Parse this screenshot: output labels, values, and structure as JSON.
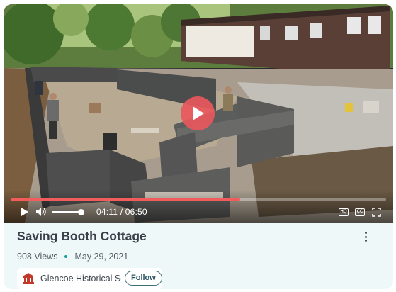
{
  "video": {
    "current_time": "04:11",
    "duration": "06:50",
    "progress": 0.612,
    "volume": 0.9,
    "hq_label": "HQ",
    "cc_label": "CC",
    "play_icon": "play-icon",
    "volume_icon": "volume-icon",
    "fullscreen_icon": "fullscreen-icon",
    "accent_color": "#f25c5c"
  },
  "info": {
    "title": "Saving Booth Cottage",
    "views": "908 Views",
    "date": "May 29, 2021",
    "more_icon": "more-vertical-icon"
  },
  "channel": {
    "name": "Glencoe Historical Society",
    "follow_label": "Follow",
    "logo_icon": "historical-society-logo-icon"
  }
}
